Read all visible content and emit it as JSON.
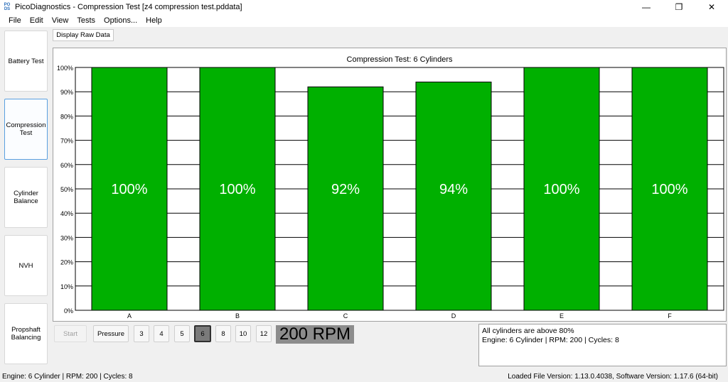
{
  "window": {
    "title": "PicoDiagnostics - Compression Test [z4 compression test.pddata]",
    "icon_text_top": "PO",
    "icon_text_bottom": "DS",
    "controls": {
      "minimize": "—",
      "restore": "❐",
      "close": "✕"
    }
  },
  "menu": [
    "File",
    "Edit",
    "View",
    "Tests",
    "Options...",
    "Help"
  ],
  "sidebar": {
    "items": [
      {
        "label": "Battery Test",
        "active": false
      },
      {
        "label": "Compression Test",
        "active": true
      },
      {
        "label": "Cylinder Balance",
        "active": false
      },
      {
        "label": "NVH",
        "active": false
      },
      {
        "label": "Propshaft Balancing",
        "active": false
      }
    ]
  },
  "toolbar": {
    "raw_data_label": "Display Raw Data"
  },
  "chart_data": {
    "type": "bar",
    "title": "Compression Test: 6 Cylinders",
    "categories": [
      "A",
      "B",
      "C",
      "D",
      "E",
      "F"
    ],
    "values": [
      100,
      100,
      92,
      94,
      100,
      100
    ],
    "value_labels": [
      "100%",
      "100%",
      "92%",
      "94%",
      "100%",
      "100%"
    ],
    "ylim": [
      0,
      100
    ],
    "yticks": [
      "0%",
      "10%",
      "20%",
      "30%",
      "40%",
      "50%",
      "60%",
      "70%",
      "80%",
      "90%",
      "100%"
    ],
    "grid": true,
    "bar_color": "#00b000",
    "label_color": "#ffffff"
  },
  "controls": {
    "start_label": "Start",
    "pressure_label": "Pressure",
    "cylinder_options": [
      "3",
      "4",
      "5",
      "6",
      "8",
      "10",
      "12"
    ],
    "selected_cylinders": "6",
    "rpm_display": "200 RPM"
  },
  "summary": {
    "line1": "All cylinders are above 80%",
    "line2": "Engine: 6 Cylinder | RPM: 200 | Cycles: 8"
  },
  "status": {
    "left": "Engine: 6 Cylinder | RPM: 200 | Cycles: 8",
    "right": "Loaded File Version: 1.13.0.4038,  Software Version: 1.17.6 (64-bit)"
  }
}
